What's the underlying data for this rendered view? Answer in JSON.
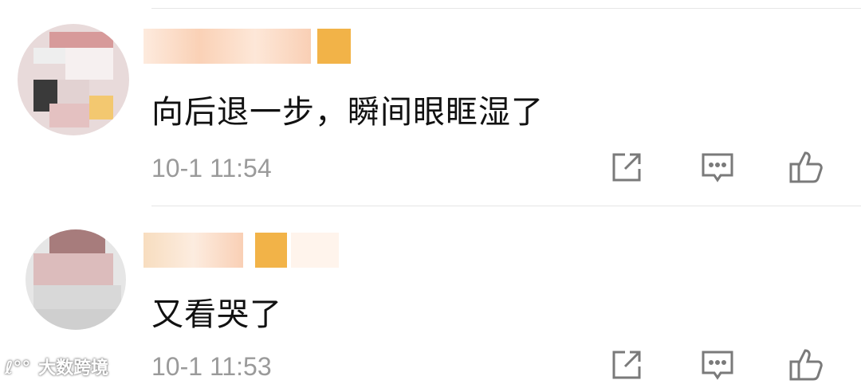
{
  "comments": [
    {
      "text": "向后退一步，瞬间眼眶湿了",
      "time": "10-1 11:54"
    },
    {
      "text": "又看哭了",
      "time": "10-1 11:53"
    }
  ],
  "actions": [
    "share-icon",
    "comment-icon",
    "like-icon"
  ],
  "colors": {
    "text": "#111111",
    "time": "#9a9a9a",
    "icon": "#7a7a7a",
    "divider": "#e6e6e6"
  },
  "watermark": {
    "logo": "ℓ°°",
    "text": "大数跨境"
  }
}
